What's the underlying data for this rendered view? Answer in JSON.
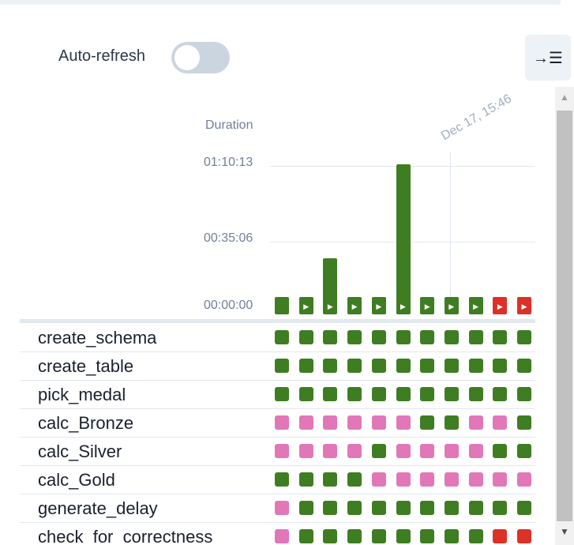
{
  "toolbar": {
    "auto_refresh_label": "Auto-refresh",
    "auto_refresh_on": false,
    "collapse_icon": "arrow-right-to-list-icon",
    "collapse_glyph": "→☰"
  },
  "chart_data": {
    "type": "bar",
    "ylabel": "Duration",
    "yticks": [
      "00:00:00",
      "00:35:06",
      "01:10:13"
    ],
    "ylim_seconds": [
      0,
      4213
    ],
    "date_marker": "Dec 17, 15:46",
    "values_seconds": [
      120,
      120,
      1580,
      120,
      120,
      4213,
      120,
      120,
      120,
      120,
      120
    ],
    "states": [
      "success",
      "success",
      "success",
      "success",
      "success",
      "success",
      "success",
      "success",
      "success",
      "failed",
      "failed"
    ],
    "play_marker": [
      false,
      true,
      true,
      true,
      true,
      true,
      true,
      true,
      true,
      true,
      true
    ]
  },
  "colors": {
    "success": "#3f7d22",
    "failed": "#dc3127",
    "upstream_failed": "#e277b8"
  },
  "tasks": [
    {
      "name": "create_schema",
      "states": [
        "s",
        "s",
        "s",
        "s",
        "s",
        "s",
        "s",
        "s",
        "s",
        "s",
        "s"
      ]
    },
    {
      "name": "create_table",
      "states": [
        "s",
        "s",
        "s",
        "s",
        "s",
        "s",
        "s",
        "s",
        "s",
        "s",
        "s"
      ]
    },
    {
      "name": "pick_medal",
      "states": [
        "s",
        "s",
        "s",
        "s",
        "s",
        "s",
        "s",
        "s",
        "s",
        "s",
        "s"
      ]
    },
    {
      "name": "calc_Bronze",
      "states": [
        "p",
        "p",
        "p",
        "p",
        "p",
        "p",
        "s",
        "s",
        "p",
        "p",
        "s"
      ]
    },
    {
      "name": "calc_Silver",
      "states": [
        "p",
        "p",
        "p",
        "p",
        "s",
        "p",
        "p",
        "p",
        "p",
        "s",
        "s"
      ]
    },
    {
      "name": "calc_Gold",
      "states": [
        "s",
        "s",
        "s",
        "s",
        "p",
        "p",
        "p",
        "p",
        "p",
        "p",
        "p"
      ]
    },
    {
      "name": "generate_delay",
      "states": [
        "p",
        "s",
        "s",
        "s",
        "s",
        "s",
        "s",
        "s",
        "s",
        "s",
        "s"
      ]
    },
    {
      "name": "check_for_correctness",
      "states": [
        "p",
        "s",
        "s",
        "s",
        "s",
        "s",
        "s",
        "s",
        "s",
        "f",
        "f"
      ]
    }
  ]
}
